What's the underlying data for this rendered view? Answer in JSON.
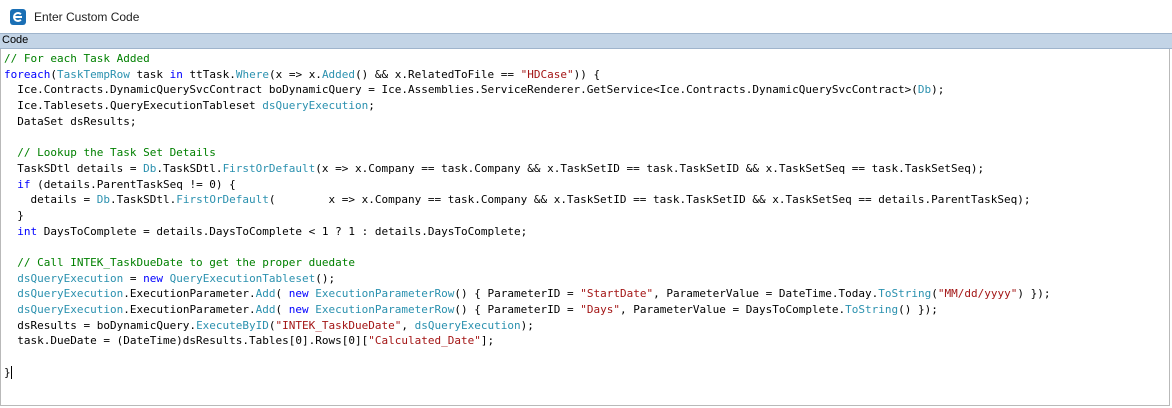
{
  "window": {
    "title": "Enter Custom Code",
    "app_icon": "epicor-e-icon"
  },
  "tab": {
    "label": "Code"
  },
  "code_lines": [
    [
      {
        "t": "cm",
        "v": "// For each Task Added"
      }
    ],
    [
      {
        "t": "kw",
        "v": "foreach"
      },
      {
        "t": "",
        "v": "("
      },
      {
        "t": "ty",
        "v": "TaskTempRow"
      },
      {
        "t": "",
        "v": " task "
      },
      {
        "t": "kw",
        "v": "in"
      },
      {
        "t": "",
        "v": " ttTask."
      },
      {
        "t": "mt",
        "v": "Where"
      },
      {
        "t": "",
        "v": "(x => x."
      },
      {
        "t": "mt",
        "v": "Added"
      },
      {
        "t": "",
        "v": "() && x.RelatedToFile == "
      },
      {
        "t": "st",
        "v": "\"HDCase\""
      },
      {
        "t": "",
        "v": ")) {"
      }
    ],
    [
      {
        "t": "",
        "v": "  Ice.Contracts.DynamicQuerySvcContract boDynamicQuery = Ice.Assemblies.ServiceRenderer.GetService<Ice.Contracts.DynamicQuerySvcContract>("
      },
      {
        "t": "mt",
        "v": "Db"
      },
      {
        "t": "",
        "v": ");"
      }
    ],
    [
      {
        "t": "",
        "v": "  Ice.Tablesets.QueryExecutionTableset "
      },
      {
        "t": "mt",
        "v": "dsQueryExecution"
      },
      {
        "t": "",
        "v": ";"
      }
    ],
    [
      {
        "t": "",
        "v": "  DataSet dsResults;"
      }
    ],
    [
      {
        "t": "",
        "v": ""
      }
    ],
    [
      {
        "t": "cm",
        "v": "  // Lookup the Task Set Details"
      }
    ],
    [
      {
        "t": "",
        "v": "  TaskSDtl details = "
      },
      {
        "t": "mt",
        "v": "Db"
      },
      {
        "t": "",
        "v": ".TaskSDtl."
      },
      {
        "t": "mt",
        "v": "FirstOrDefault"
      },
      {
        "t": "",
        "v": "(x => x.Company == task.Company && x.TaskSetID == task.TaskSetID && x.TaskSetSeq == task.TaskSetSeq);"
      }
    ],
    [
      {
        "t": "",
        "v": "  "
      },
      {
        "t": "kw",
        "v": "if"
      },
      {
        "t": "",
        "v": " (details.ParentTaskSeq != 0) {"
      }
    ],
    [
      {
        "t": "",
        "v": "    details = "
      },
      {
        "t": "mt",
        "v": "Db"
      },
      {
        "t": "",
        "v": ".TaskSDtl."
      },
      {
        "t": "mt",
        "v": "FirstOrDefault"
      },
      {
        "t": "",
        "v": "(        x => x.Company == task.Company && x.TaskSetID == task.TaskSetID && x.TaskSetSeq == details.ParentTaskSeq);"
      }
    ],
    [
      {
        "t": "",
        "v": "  }"
      }
    ],
    [
      {
        "t": "",
        "v": "  "
      },
      {
        "t": "kw",
        "v": "int"
      },
      {
        "t": "",
        "v": " DaysToComplete = details.DaysToComplete < 1 ? 1 : details.DaysToComplete;"
      }
    ],
    [
      {
        "t": "",
        "v": ""
      }
    ],
    [
      {
        "t": "cm",
        "v": "  // Call INTEK_TaskDueDate to get the proper duedate"
      }
    ],
    [
      {
        "t": "",
        "v": "  "
      },
      {
        "t": "mt",
        "v": "dsQueryExecution"
      },
      {
        "t": "",
        "v": " = "
      },
      {
        "t": "kw",
        "v": "new"
      },
      {
        "t": "",
        "v": " "
      },
      {
        "t": "ty",
        "v": "QueryExecutionTableset"
      },
      {
        "t": "",
        "v": "();"
      }
    ],
    [
      {
        "t": "",
        "v": "  "
      },
      {
        "t": "mt",
        "v": "dsQueryExecution"
      },
      {
        "t": "",
        "v": ".ExecutionParameter."
      },
      {
        "t": "mt",
        "v": "Add"
      },
      {
        "t": "",
        "v": "( "
      },
      {
        "t": "kw",
        "v": "new"
      },
      {
        "t": "",
        "v": " "
      },
      {
        "t": "ty",
        "v": "ExecutionParameterRow"
      },
      {
        "t": "",
        "v": "() { ParameterID = "
      },
      {
        "t": "st",
        "v": "\"StartDate\""
      },
      {
        "t": "",
        "v": ", ParameterValue = DateTime.Today."
      },
      {
        "t": "mt",
        "v": "ToString"
      },
      {
        "t": "",
        "v": "("
      },
      {
        "t": "st",
        "v": "\"MM/dd/yyyy\""
      },
      {
        "t": "",
        "v": ") });"
      }
    ],
    [
      {
        "t": "",
        "v": "  "
      },
      {
        "t": "mt",
        "v": "dsQueryExecution"
      },
      {
        "t": "",
        "v": ".ExecutionParameter."
      },
      {
        "t": "mt",
        "v": "Add"
      },
      {
        "t": "",
        "v": "( "
      },
      {
        "t": "kw",
        "v": "new"
      },
      {
        "t": "",
        "v": " "
      },
      {
        "t": "ty",
        "v": "ExecutionParameterRow"
      },
      {
        "t": "",
        "v": "() { ParameterID = "
      },
      {
        "t": "st",
        "v": "\"Days\""
      },
      {
        "t": "",
        "v": ", ParameterValue = DaysToComplete."
      },
      {
        "t": "mt",
        "v": "ToString"
      },
      {
        "t": "",
        "v": "() });"
      }
    ],
    [
      {
        "t": "",
        "v": "  dsResults = boDynamicQuery."
      },
      {
        "t": "mt",
        "v": "ExecuteByID"
      },
      {
        "t": "",
        "v": "("
      },
      {
        "t": "st",
        "v": "\"INTEK_TaskDueDate\""
      },
      {
        "t": "",
        "v": ", "
      },
      {
        "t": "mt",
        "v": "dsQueryExecution"
      },
      {
        "t": "",
        "v": ");"
      }
    ],
    [
      {
        "t": "",
        "v": "  task.DueDate = (DateTime)dsResults.Tables[0].Rows[0]["
      },
      {
        "t": "st",
        "v": "\"Calculated_Date\""
      },
      {
        "t": "",
        "v": "];"
      }
    ],
    [
      {
        "t": "",
        "v": ""
      }
    ],
    [
      {
        "t": "",
        "v": "}"
      }
    ]
  ]
}
